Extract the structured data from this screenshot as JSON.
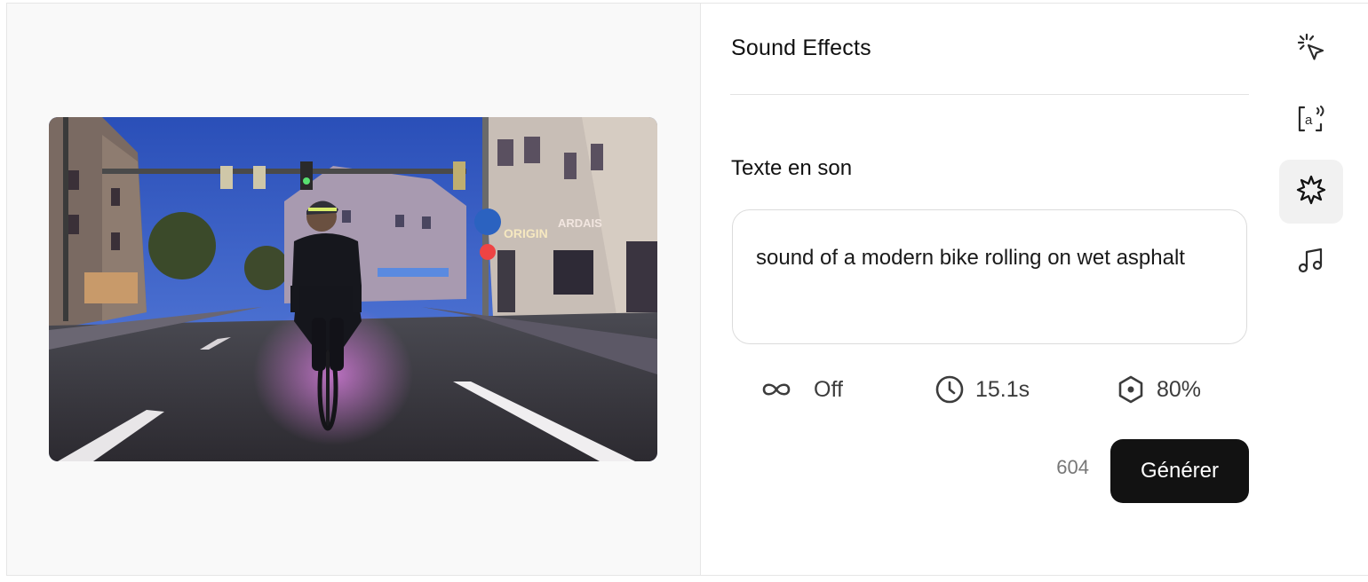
{
  "panel": {
    "title": "Sound Effects",
    "section_label": "Texte en son",
    "prompt": {
      "value": "sound of a modern bike rolling on wet asphalt"
    },
    "settings": {
      "loop": {
        "icon": "infinity-icon",
        "value": "Off"
      },
      "duration": {
        "icon": "clock-icon",
        "value": "15.1s"
      },
      "prompt_influence": {
        "icon": "hexagon-dial-icon",
        "value": "80%"
      }
    },
    "char_count": "604",
    "generate_label": "Générer"
  },
  "tool_rail": {
    "items": [
      {
        "icon": "sparkle-cursor-icon",
        "active": false
      },
      {
        "icon": "text-to-speech-icon",
        "active": false
      },
      {
        "icon": "starburst-icon",
        "active": true
      },
      {
        "icon": "music-note-icon",
        "active": false
      }
    ]
  },
  "preview": {
    "image": "video-frame-cyclist-night-street"
  },
  "colors": {
    "button_bg": "#121212",
    "active_tool_bg": "#f1f1f1",
    "border": "#dcdcdc"
  }
}
